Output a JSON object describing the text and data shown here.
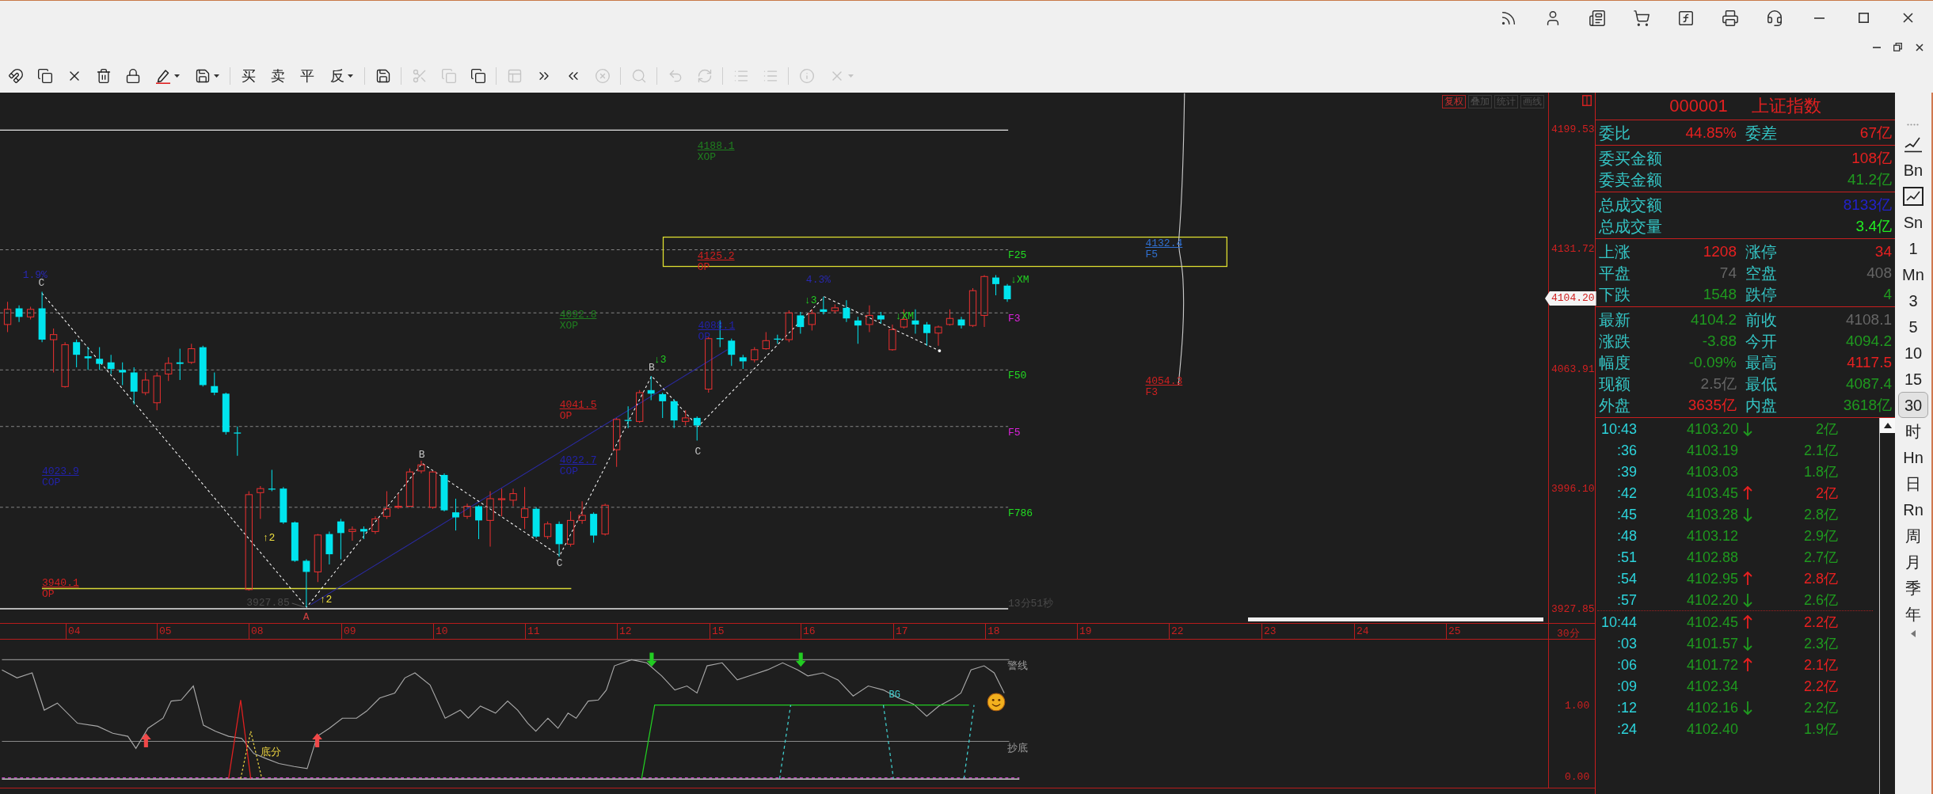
{
  "toolbar": [
    {
      "kind": "icon",
      "disabled": false,
      "dropdown": false
    },
    {
      "kind": "icon",
      "disabled": false,
      "dropdown": false
    },
    {
      "kind": "icon",
      "disabled": false,
      "dropdown": false
    },
    {
      "kind": "icon",
      "disabled": false,
      "dropdown": false
    },
    {
      "kind": "icon",
      "disabled": false,
      "dropdown": false
    },
    {
      "kind": "icon",
      "disabled": false,
      "dropdown": true
    },
    {
      "kind": "icon",
      "disabled": false,
      "dropdown": true
    },
    {
      "kind": "text",
      "label": "买",
      "disabled": false,
      "dropdown": false
    },
    {
      "kind": "text",
      "label": "卖",
      "disabled": false,
      "dropdown": false
    },
    {
      "kind": "text",
      "label": "平",
      "disabled": false,
      "dropdown": false
    },
    {
      "kind": "text",
      "label": "反",
      "disabled": false,
      "dropdown": true
    },
    {
      "kind": "icon",
      "disabled": false,
      "dropdown": false
    },
    {
      "kind": "icon",
      "disabled": true,
      "dropdown": false
    },
    {
      "kind": "icon",
      "disabled": true,
      "dropdown": false
    },
    {
      "kind": "icon",
      "disabled": false,
      "dropdown": false
    },
    {
      "kind": "icon",
      "disabled": true,
      "dropdown": false
    },
    {
      "kind": "icon",
      "disabled": false,
      "dropdown": false
    },
    {
      "kind": "icon",
      "disabled": false,
      "dropdown": false
    },
    {
      "kind": "icon",
      "disabled": true,
      "dropdown": false
    },
    {
      "kind": "icon",
      "disabled": true,
      "dropdown": false
    },
    {
      "kind": "icon",
      "disabled": true,
      "dropdown": false
    },
    {
      "kind": "icon",
      "disabled": true,
      "dropdown": false
    },
    {
      "kind": "icon",
      "disabled": true,
      "dropdown": false
    },
    {
      "kind": "icon",
      "disabled": true,
      "dropdown": false
    },
    {
      "kind": "icon",
      "disabled": true,
      "dropdown": false
    },
    {
      "kind": "icon",
      "disabled": true,
      "dropdown": true
    }
  ],
  "chart": {
    "view_buttons": [
      {
        "label": "复权",
        "selected": true
      },
      {
        "label": "叠加",
        "selected": false
      },
      {
        "label": "统计",
        "selected": false
      },
      {
        "label": "画线",
        "selected": false
      }
    ],
    "price_axis": [
      "4199.53",
      "4131.72",
      "4063.91",
      "3996.10",
      "3927.85"
    ],
    "last_price": "4104.20",
    "fib_levels": [
      {
        "label": "F25",
        "color": "#22dd22"
      },
      {
        "label": "F3",
        "color": "#dd22dd"
      },
      {
        "label": "F50",
        "color": "#22dd22"
      },
      {
        "label": "F5",
        "color": "#dd22dd"
      },
      {
        "label": "F786",
        "color": "#22dd22"
      }
    ],
    "targets": [
      {
        "value": "4188.1",
        "tag": "XOP",
        "color": "#1f7f1f"
      },
      {
        "value": "4125.2",
        "tag": "OP",
        "color": "#d02020"
      },
      {
        "value": "4092.8",
        "tag": "XOP",
        "color": "#1f7f1f"
      },
      {
        "value": "4041.5",
        "tag": "OP",
        "color": "#d02020"
      },
      {
        "value": "4022.7",
        "tag": "COP",
        "color": "#2222aa"
      },
      {
        "value": "4023.9",
        "tag": "COP",
        "color": "#2222aa"
      },
      {
        "value": "3940.1",
        "tag": "OP",
        "color": "#d02020"
      },
      {
        "value": "4088.1",
        "tag": "OP",
        "color": "#2222aa"
      },
      {
        "value": "4132.4",
        "tag": "F5",
        "color": "#3070d0"
      },
      {
        "value": "4054.3",
        "tag": "F3",
        "color": "#d02020"
      }
    ],
    "wave_labels": [
      {
        "text": "C",
        "color": "#c8c8c8"
      },
      {
        "text": "B",
        "color": "#c8c8c8"
      },
      {
        "text": "A",
        "color": "#d04040"
      },
      {
        "text": "C",
        "color": "#c8c8c8"
      },
      {
        "text": "B",
        "color": "#c8c8c8"
      },
      {
        "text": "C",
        "color": "#c8c8c8"
      }
    ],
    "signals": [
      {
        "text": "↓3",
        "color": "#22cc22"
      },
      {
        "text": "↓3",
        "color": "#22cc22"
      },
      {
        "text": "↓XM",
        "color": "#22cc22"
      },
      {
        "text": "↓XM",
        "color": "#22cc22"
      },
      {
        "text": "↑2",
        "color": "#f0e040"
      },
      {
        "text": "↑2",
        "color": "#f0e040"
      }
    ],
    "percent_labels": [
      "1.9%",
      "4.3%"
    ],
    "low_label": "3927.85",
    "countdown": "13分51秒"
  },
  "date_axis": {
    "dates": [
      "04",
      "05",
      "08",
      "09",
      "10",
      "11",
      "12",
      "15",
      "16",
      "17",
      "18",
      "19",
      "22",
      "23",
      "24",
      "25"
    ],
    "period": "30分"
  },
  "indicator": {
    "line_labels": [
      "警线",
      "抄底"
    ],
    "bottom_tag": "底分",
    "signal_tag": "BG",
    "axis": [
      "1.00",
      "0.00"
    ]
  },
  "quote": {
    "code": "000001",
    "name": "上证指数",
    "sections": [
      {
        "rows": [
          [
            {
              "label": "委比",
              "value": "44.85%",
              "color": "#e82020"
            },
            {
              "label": "委差",
              "value": "67亿",
              "color": "#e82020"
            }
          ]
        ]
      },
      {
        "rows": [
          [
            {
              "label": "委买金额",
              "value": "108亿",
              "color": "#e82020"
            }
          ],
          [
            {
              "label": "委卖金额",
              "value": "41.2亿",
              "color": "#1f9a1f"
            }
          ]
        ]
      },
      {
        "rows": [
          [
            {
              "label": "总成交额",
              "value": "8133亿",
              "color": "#2222cc"
            }
          ],
          [
            {
              "label": "总成交量",
              "value": "3.4亿",
              "color": "#22ee22"
            }
          ]
        ]
      },
      {
        "rows": [
          [
            {
              "label": "上涨",
              "value": "1208",
              "color": "#e82020"
            },
            {
              "label": "涨停",
              "value": "34",
              "color": "#e82020"
            }
          ],
          [
            {
              "label": "平盘",
              "value": "74",
              "color": "#666666"
            },
            {
              "label": "空盘",
              "value": "408",
              "color": "#666666"
            }
          ],
          [
            {
              "label": "下跌",
              "value": "1548",
              "color": "#1f9a1f"
            },
            {
              "label": "跌停",
              "value": "4",
              "color": "#1f9a1f"
            }
          ]
        ]
      },
      {
        "rows": [
          [
            {
              "label": "最新",
              "value": "4104.2",
              "color": "#1f9a1f"
            },
            {
              "label": "前收",
              "value": "4108.1",
              "color": "#666666"
            }
          ],
          [
            {
              "label": "涨跌",
              "value": "-3.88",
              "color": "#1f9a1f"
            },
            {
              "label": "今开",
              "value": "4094.2",
              "color": "#1f9a1f"
            }
          ],
          [
            {
              "label": "幅度",
              "value": "-0.09%",
              "color": "#1f9a1f"
            },
            {
              "label": "最高",
              "value": "4117.5",
              "color": "#e82020"
            }
          ],
          [
            {
              "label": "现额",
              "value": "2.5亿",
              "color": "#666666"
            },
            {
              "label": "最低",
              "value": "4087.4",
              "color": "#1f9a1f"
            }
          ],
          [
            {
              "label": "外盘",
              "value": "3635亿",
              "color": "#e82020"
            },
            {
              "label": "内盘",
              "value": "3618亿",
              "color": "#1f9a1f"
            }
          ]
        ]
      }
    ]
  },
  "ticks": [
    {
      "time": "10:43",
      "price": "4103.20",
      "uptick": false,
      "downtick": true,
      "volume": "2亿",
      "buy": false,
      "divider_above": false
    },
    {
      "time": ":36",
      "price": "4103.19",
      "uptick": false,
      "downtick": false,
      "volume": "2.1亿",
      "buy": false,
      "divider_above": false
    },
    {
      "time": ":39",
      "price": "4103.03",
      "uptick": false,
      "downtick": false,
      "volume": "1.8亿",
      "buy": false,
      "divider_above": false
    },
    {
      "time": ":42",
      "price": "4103.45",
      "uptick": true,
      "downtick": false,
      "volume": "2亿",
      "buy": true,
      "divider_above": false
    },
    {
      "time": ":45",
      "price": "4103.28",
      "uptick": false,
      "downtick": true,
      "volume": "2.8亿",
      "buy": false,
      "divider_above": false
    },
    {
      "time": ":48",
      "price": "4103.12",
      "uptick": false,
      "downtick": false,
      "volume": "2.9亿",
      "buy": false,
      "divider_above": false
    },
    {
      "time": ":51",
      "price": "4102.88",
      "uptick": false,
      "downtick": false,
      "volume": "2.7亿",
      "buy": false,
      "divider_above": false
    },
    {
      "time": ":54",
      "price": "4102.95",
      "uptick": true,
      "downtick": false,
      "volume": "2.8亿",
      "buy": true,
      "divider_above": false
    },
    {
      "time": ":57",
      "price": "4102.20",
      "uptick": false,
      "downtick": true,
      "volume": "2.6亿",
      "buy": false,
      "divider_above": false
    },
    {
      "time": "10:44",
      "price": "4102.45",
      "uptick": true,
      "downtick": false,
      "volume": "2.2亿",
      "buy": true,
      "divider_above": true
    },
    {
      "time": ":03",
      "price": "4101.57",
      "uptick": false,
      "downtick": true,
      "volume": "2.3亿",
      "buy": false,
      "divider_above": false
    },
    {
      "time": ":06",
      "price": "4101.72",
      "uptick": true,
      "downtick": false,
      "volume": "2.1亿",
      "buy": true,
      "divider_above": false
    },
    {
      "time": ":09",
      "price": "4102.34",
      "uptick": false,
      "downtick": false,
      "volume": "2.2亿",
      "buy": true,
      "divider_above": false
    },
    {
      "time": ":12",
      "price": "4102.16",
      "uptick": false,
      "downtick": true,
      "volume": "2.2亿",
      "buy": false,
      "divider_above": false
    },
    {
      "time": ":24",
      "price": "4102.40",
      "uptick": false,
      "downtick": false,
      "volume": "1.9亿",
      "buy": false,
      "divider_above": false
    }
  ],
  "periods": [
    {
      "kind": "icon",
      "selected": false
    },
    {
      "kind": "icon",
      "selected": false
    },
    {
      "kind": "text",
      "label": "Bn",
      "selected": false
    },
    {
      "kind": "icon",
      "selected": true
    },
    {
      "kind": "text",
      "label": "Sn",
      "selected": false
    },
    {
      "kind": "text",
      "label": "1",
      "selected": false
    },
    {
      "kind": "text",
      "label": "Mn",
      "selected": false
    },
    {
      "kind": "text",
      "label": "3",
      "selected": false
    },
    {
      "kind": "text",
      "label": "5",
      "selected": false
    },
    {
      "kind": "text",
      "label": "10",
      "selected": false
    },
    {
      "kind": "text",
      "label": "15",
      "selected": false
    },
    {
      "kind": "text",
      "label": "30",
      "selected": true
    },
    {
      "kind": "text",
      "label": "时",
      "selected": false
    },
    {
      "kind": "text",
      "label": "Hn",
      "selected": false
    },
    {
      "kind": "text",
      "label": "日",
      "selected": false
    },
    {
      "kind": "text",
      "label": "Rn",
      "selected": false
    },
    {
      "kind": "text",
      "label": "周",
      "selected": false
    },
    {
      "kind": "text",
      "label": "月",
      "selected": false
    },
    {
      "kind": "text",
      "label": "季",
      "selected": false
    },
    {
      "kind": "text",
      "label": "年",
      "selected": false
    },
    {
      "kind": "icon",
      "selected": false
    }
  ]
}
